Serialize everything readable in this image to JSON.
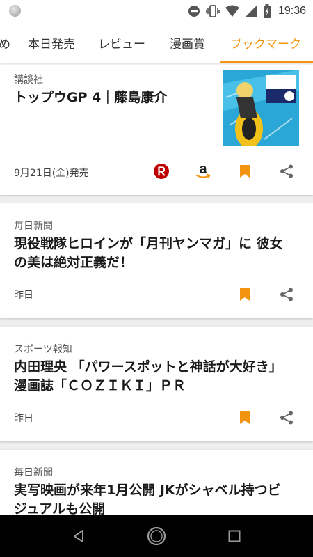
{
  "status_bar": {
    "time": "19:36",
    "icons": [
      "notification-dot-icon",
      "do-not-disturb-icon",
      "vibrate-icon",
      "wifi-icon",
      "cellular-icon",
      "battery-charging-icon"
    ]
  },
  "tabs": [
    {
      "label": "め",
      "active": false
    },
    {
      "label": "本日発売",
      "active": false
    },
    {
      "label": "レビュー",
      "active": false
    },
    {
      "label": "漫画賞",
      "active": false
    },
    {
      "label": "ブックマーク",
      "active": true
    }
  ],
  "accent_color": "#f39410",
  "cards": [
    {
      "source": "講談社",
      "headline": "トップウGP 4｜藤島康介",
      "date": "9月21日(金)発売",
      "has_cover": true,
      "cover": {
        "label_lines": [
          "トップウGP",
          "藤島康介"
        ],
        "volume": "4"
      },
      "actions": [
        "rakuten-icon",
        "amazon-icon",
        "bookmark-icon",
        "share-icon"
      ]
    },
    {
      "source": "毎日新聞",
      "headline_lines": [
        "現役戦隊ヒロインが「月刊ヤンマガ」に 彼女",
        "の美は絶対正義だ！"
      ],
      "date": "昨日",
      "actions": [
        "bookmark-icon",
        "share-icon"
      ]
    },
    {
      "source": "スポーツ報知",
      "headline_lines": [
        "内田理央 「パワースポットと神話が大好き」",
        "漫画誌「ＣＯＺＩＫＩ」ＰＲ"
      ],
      "date": "昨日",
      "actions": [
        "bookmark-icon",
        "share-icon"
      ]
    },
    {
      "source": "毎日新聞",
      "headline_lines": [
        "実写映画が来年1月公開 JKがシャベル持つビ",
        "ジュアルも公開"
      ],
      "actions": []
    }
  ],
  "nav_bar": {
    "buttons": [
      "back-icon",
      "home-icon",
      "recents-icon"
    ]
  }
}
